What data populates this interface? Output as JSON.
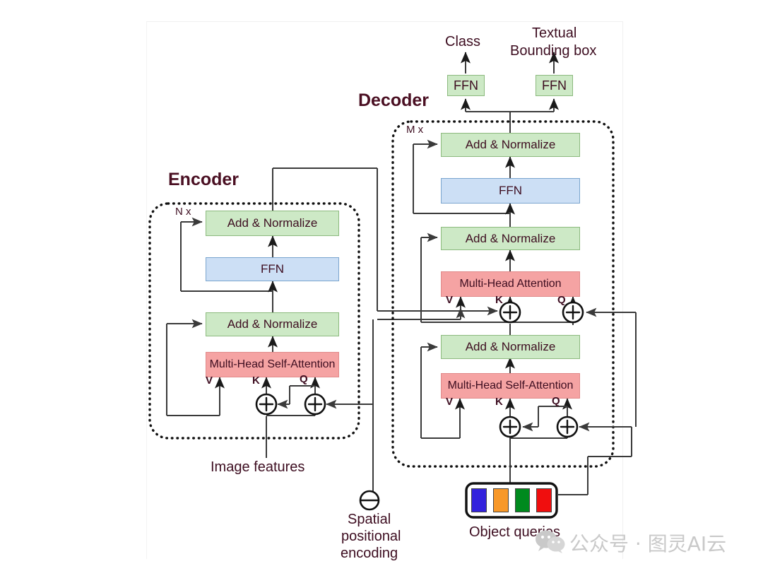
{
  "figure": {
    "type": "architecture-diagram",
    "subject": "Transformer encoder-decoder (DETR-style) with textual bounding box head"
  },
  "outputs": {
    "class_label": "Class",
    "bbox_label_line1": "Textual",
    "bbox_label_line2": "Bounding box",
    "ffn_left": "FFN",
    "ffn_right": "FFN"
  },
  "encoder": {
    "title": "Encoder",
    "repeat": "N x",
    "blocks": {
      "add_norm_top": "Add  &  Normalize",
      "ffn": "FFN",
      "add_norm_bottom": "Add  &  Normalize",
      "attention": "Multi-Head Self-Attention"
    },
    "qkv": {
      "v": "V",
      "k": "K",
      "q": "Q"
    },
    "input_label": "Image features"
  },
  "decoder": {
    "title": "Decoder",
    "repeat": "M x",
    "blocks": {
      "add_norm_top": "Add  &  Normalize",
      "ffn": "FFN",
      "add_norm_mid": "Add  &  Normalize",
      "cross_attention": "Multi-Head Attention",
      "add_norm_bottom": "Add  &  Normalize",
      "self_attention": "Multi-Head Self-Attention"
    },
    "qkv_cross": {
      "v": "V",
      "k": "K",
      "q": "Q"
    },
    "qkv_self": {
      "v": "V",
      "k": "K",
      "q": "Q"
    },
    "input_label": "Object queries",
    "query_colors": [
      "#3322dd",
      "#f89828",
      "#008a1e",
      "#f00e0e"
    ]
  },
  "spatial_encoding": {
    "line1": "Spatial",
    "line2": "positional",
    "line3": "encoding",
    "symbol": "circle-minus"
  },
  "operators": {
    "sum": "+"
  },
  "watermark": {
    "text": "公众号 · 图灵AI云",
    "logo": "wechat-icon"
  },
  "colors": {
    "green_fill": "#cde9c6",
    "green_stroke": "#8cba7e",
    "blue_fill": "#ccdff5",
    "blue_stroke": "#7aa5ce",
    "red_fill": "#f5a3a3",
    "red_stroke": "#e08a8a",
    "text": "#3d0d20",
    "line": "#3a3a3a"
  }
}
